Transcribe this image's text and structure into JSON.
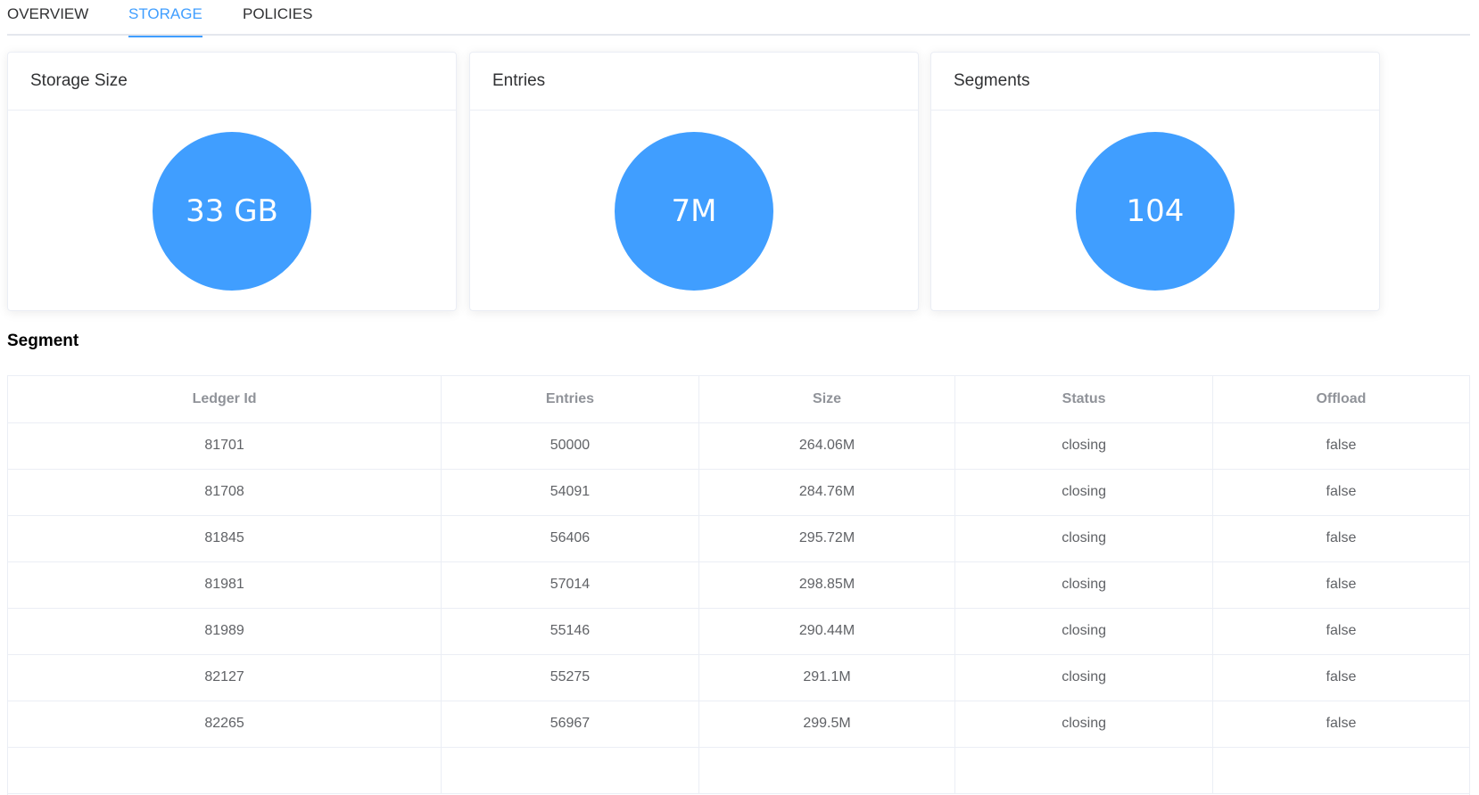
{
  "tabs": [
    {
      "label": "OVERVIEW",
      "active": false
    },
    {
      "label": "STORAGE",
      "active": true
    },
    {
      "label": "POLICIES",
      "active": false
    }
  ],
  "cards": [
    {
      "title": "Storage Size",
      "value": "33 GB"
    },
    {
      "title": "Entries",
      "value": "7M"
    },
    {
      "title": "Segments",
      "value": "104"
    }
  ],
  "segment": {
    "title": "Segment",
    "columns": [
      "Ledger Id",
      "Entries",
      "Size",
      "Status",
      "Offload"
    ],
    "rows": [
      [
        "81701",
        "50000",
        "264.06M",
        "closing",
        "false"
      ],
      [
        "81708",
        "54091",
        "284.76M",
        "closing",
        "false"
      ],
      [
        "81845",
        "56406",
        "295.72M",
        "closing",
        "false"
      ],
      [
        "81981",
        "57014",
        "298.85M",
        "closing",
        "false"
      ],
      [
        "81989",
        "55146",
        "290.44M",
        "closing",
        "false"
      ],
      [
        "82127",
        "55275",
        "291.1M",
        "closing",
        "false"
      ],
      [
        "82265",
        "56967",
        "299.5M",
        "closing",
        "false"
      ]
    ]
  },
  "colors": {
    "accent": "#409eff",
    "border": "#ebeef5",
    "header_text": "#909399",
    "cell_text": "#606266"
  }
}
